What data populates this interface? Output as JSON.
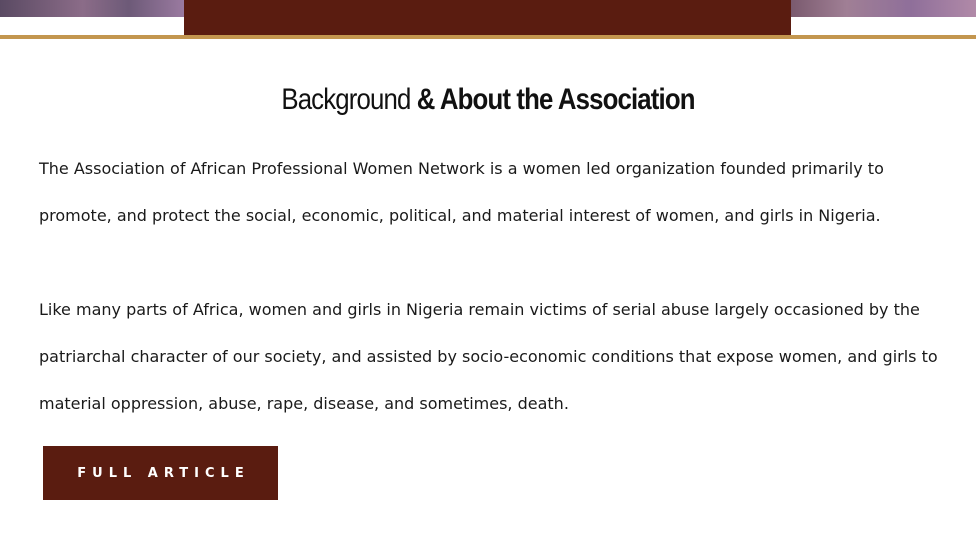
{
  "hero": {
    "accent_color": "#5a1c10",
    "rule_color": "#c3964f"
  },
  "section": {
    "heading_light": "Background",
    "heading_bold": "& About the Association",
    "paragraph_1": "The Association of African Professional Women Network is a women led organization founded primarily to promote, and protect the social, economic, political, and material interest of women, and girls in Nigeria.",
    "paragraph_2": "Like many parts of Africa, women and girls in Nigeria remain victims of serial abuse largely occasioned by the patriarchal character of our society, and assisted by socio-economic conditions that expose women, and girls to material oppression, abuse, rape, disease, and sometimes, death.",
    "button_label": "FULL ARTICLE"
  }
}
